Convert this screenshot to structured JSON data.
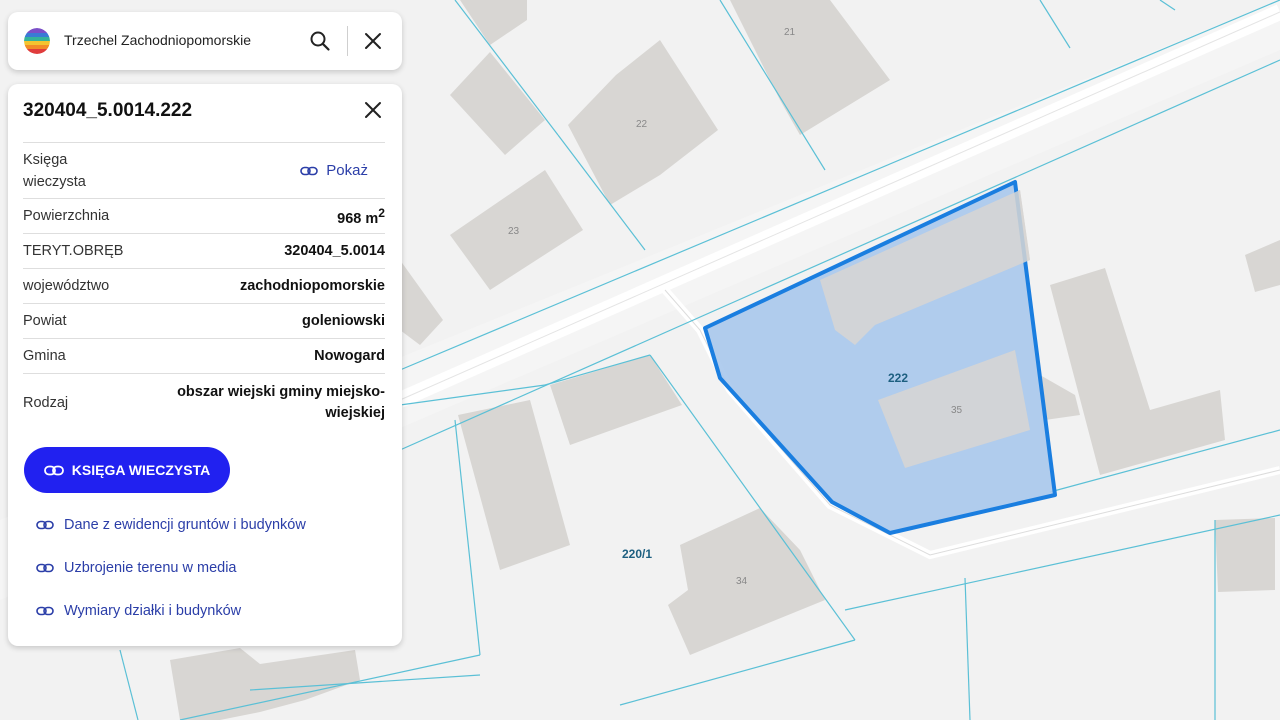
{
  "search": {
    "query": "Trzechel Zachodniopomorskie",
    "search_icon": "magnifier-icon",
    "close_icon": "close-x-icon",
    "logo_icon": "rainbow-circle-logo"
  },
  "panel": {
    "title": "320404_5.0014.222",
    "close_icon": "close-x-icon",
    "rows": {
      "ksiega": {
        "label": "Księga wieczysta",
        "link": "Pokaż"
      },
      "powierzchnia": {
        "label": "Powierzchnia",
        "value": "968 m",
        "unit_sup": "2"
      },
      "teryt": {
        "label": "TERYT.OBRĘB",
        "value": "320404_5.0014"
      },
      "wojewodztwo": {
        "label": "województwo",
        "value": "zachodniopomorskie"
      },
      "powiat": {
        "label": "Powiat",
        "value": "goleniowski"
      },
      "gmina": {
        "label": "Gmina",
        "value": "Nowogard"
      },
      "rodzaj": {
        "label": "Rodzaj",
        "value": "obszar wiejski gminy miejsko-wiejskiej"
      }
    },
    "primary_button": "KSIĘGA WIECZYSTA",
    "links": [
      "Dane z ewidencji gruntów i budynków",
      "Uzbrojenie terenu w media",
      "Wymiary działki i budynków"
    ],
    "link_icon": "chain-link-icon"
  },
  "map": {
    "building_numbers": [
      "21",
      "22",
      "23",
      "35",
      "34"
    ],
    "parcel_labels": [
      "222",
      "220/1"
    ]
  },
  "colors": {
    "accent": "#2121f0",
    "link": "#2b3ea8",
    "parcel_fill": "#a9c8ec",
    "parcel_outline": "#1a7ee0",
    "cadastral_line": "#5bc0d6",
    "building": "#d8d6d3"
  }
}
